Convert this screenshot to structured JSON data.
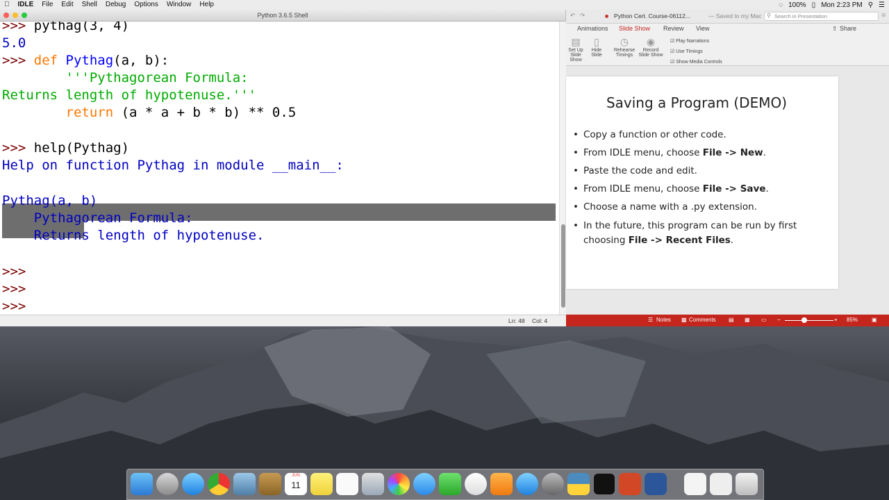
{
  "menubar": {
    "app_name": "IDLE",
    "items": [
      "File",
      "Edit",
      "Shell",
      "Debug",
      "Options",
      "Window",
      "Help"
    ],
    "battery": "100%",
    "clock": "Mon 2:23 PM"
  },
  "idle": {
    "title": "Python 3.6.5 Shell",
    "status_line": "Ln: 48",
    "status_col": "Col: 4",
    "lines": {
      "l1_prompt": ">>> ",
      "l1_code": "pythag(3, 4)",
      "l2": "5.0",
      "l3_prompt": ">>> ",
      "l3_kw": "def ",
      "l3_name": "Pythag",
      "l3_rest": "(a, b):",
      "l4": "        '''Pythagorean Formula:",
      "l5": "Returns length of hypotenuse.'''",
      "l6_indent": "        ",
      "l6_kw": "return",
      "l6_rest": " (a * a + b * b) ** 0.5",
      "l7_prompt": ">>> ",
      "l7_code": "help(Pythag)",
      "l8": "Help on function Pythag in module __main__:",
      "l9": "Pythag(a, b)",
      "l10": "    Pythagorean Formula:",
      "l11": "    Returns length of hypotenuse.",
      "p1": ">>>",
      "p2": ">>>",
      "p3": ">>>"
    }
  },
  "ppt": {
    "doc_title": "Python Cert. Course-06112...",
    "saved": "— Saved to my Mac",
    "search_placeholder": "Search in Presentation",
    "tabs": [
      "Animations",
      "Slide Show",
      "Review",
      "View"
    ],
    "share": "Share",
    "ribbon": {
      "setup": "Set Up Slide Show",
      "hide": "Hide Slide",
      "rehearse": "Rehearse Timings",
      "record": "Record Slide Show",
      "opt1": "Play Narrations",
      "opt2": "Use Timings",
      "opt3": "Show Media Controls"
    },
    "slide": {
      "title": "Saving a Program (DEMO)",
      "b1": "Copy a function or other code.",
      "b2_pre": "From IDLE menu, choose ",
      "b2_bold": "File -> New",
      "b2_post": ".",
      "b3": "Paste the code and edit.",
      "b4_pre": "From IDLE menu, choose ",
      "b4_bold": "File -> Save",
      "b4_post": ".",
      "b5": "Choose a name with a .py extension.",
      "b6_pre": "In the future, this program can be run by first choosing ",
      "b6_bold": "File -> Recent Files",
      "b6_post": "."
    },
    "status": {
      "notes": "Notes",
      "comments": "Comments",
      "zoom": "85%"
    }
  },
  "dock": {
    "calendar_day": "11",
    "calendar_month": "JUN"
  },
  "colors": {
    "prompt": "#7a0000",
    "keyword": "#ff7700",
    "definition": "#0000ff",
    "string": "#00aa00",
    "output": "#0000c0",
    "ppt_accent": "#c4261d"
  }
}
